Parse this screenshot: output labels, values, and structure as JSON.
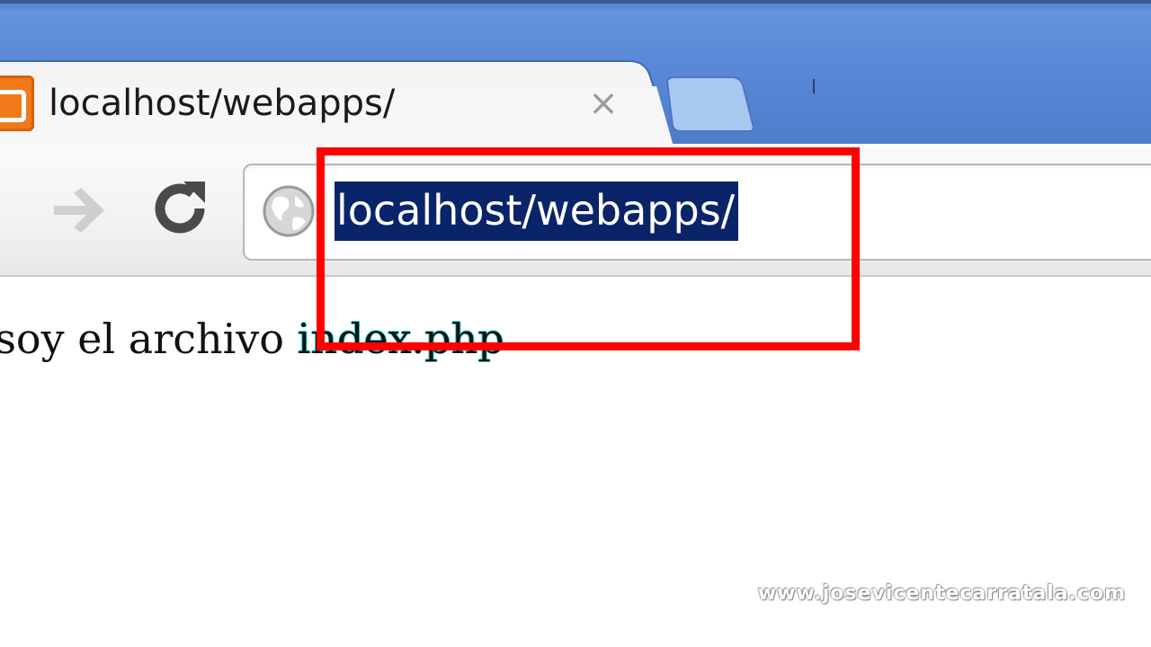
{
  "browser": {
    "tab": {
      "title": "localhost/webapps/",
      "favicon": "xampp-icon",
      "close_icon": "close-icon",
      "close_glyph": "×"
    },
    "new_tab_icon": "new-tab-icon",
    "toolbar": {
      "back_icon": "back-arrow-icon",
      "forward_icon": "forward-arrow-icon",
      "reload_icon": "reload-icon"
    },
    "omnibox": {
      "icon": "globe-icon",
      "value": "localhost/webapps/",
      "selected": true
    }
  },
  "page": {
    "text_before": "o soy el archivo ",
    "text_highlight": "index.php"
  },
  "annotation": {
    "color": "#ff0000"
  },
  "watermark": {
    "text": "www.josevicentecarratala.com"
  },
  "colors": {
    "titlebar": "#5a8ad8",
    "selection": "#0a246a",
    "favicon": "#f07a1a"
  }
}
